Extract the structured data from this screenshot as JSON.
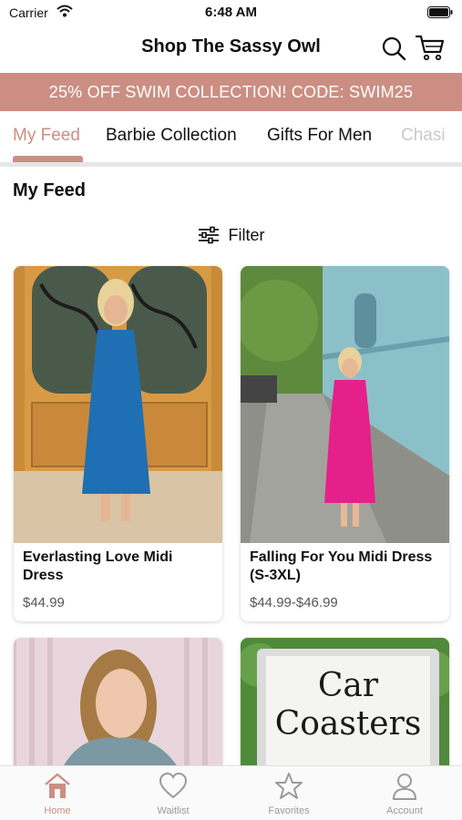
{
  "status_bar": {
    "carrier": "Carrier",
    "time": "6:48 AM"
  },
  "header": {
    "title": "Shop The Sassy Owl"
  },
  "promo": {
    "text": "25% OFF SWIM COLLECTION! CODE: SWIM25"
  },
  "tabs": [
    {
      "label": "My Feed"
    },
    {
      "label": "Barbie Collection"
    },
    {
      "label": "Gifts For Men"
    },
    {
      "label": "Chasi"
    }
  ],
  "feed": {
    "title": "My Feed",
    "filter_label": "Filter"
  },
  "products": [
    {
      "name": "Everlasting Love Midi Dress",
      "price": "$44.99"
    },
    {
      "name": "Falling For You Midi Dress (S-3XL)",
      "price": "$44.99-$46.99"
    },
    {
      "name": "",
      "price": ""
    },
    {
      "name": "Car Coasters",
      "price": ""
    }
  ],
  "bottom_nav": [
    {
      "label": "Home"
    },
    {
      "label": "Waitlist"
    },
    {
      "label": "Favorites"
    },
    {
      "label": "Account"
    }
  ],
  "colors": {
    "accent": "#cc8e83",
    "inactive": "#9a9a9a"
  },
  "icons": [
    "wifi-icon",
    "battery-icon",
    "search-icon",
    "cart-icon",
    "filter-icon",
    "home-icon",
    "heart-icon",
    "star-icon",
    "account-icon"
  ]
}
